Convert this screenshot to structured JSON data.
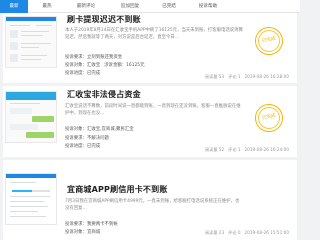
{
  "tabs": [
    {
      "label": "最新"
    },
    {
      "label": "最热"
    },
    {
      "label": "最新评论"
    },
    {
      "label": "追加回复"
    },
    {
      "label": "已完结"
    },
    {
      "label": "投诉帮助"
    }
  ],
  "complaints": [
    {
      "title": "刷卡提现迟迟不到账",
      "excerpt": "本人于2019年8月14日在汇收宝手机APP中刷了16125元，当天未到账，打客服电话说清算延迟，然后我就等了两天，对方说是后台延迟，直至今日…",
      "target_label": "投诉对象：",
      "target": "汇收宝",
      "demand_label": "投诉要求：",
      "demand": "立刻到账还我资金",
      "amount_label": "涉诉金额：",
      "amount": "16125元",
      "progress_label": "投诉进度：",
      "progress": "已完成",
      "views": "阅读量 53",
      "comments": "评论 1",
      "date": "2019-08-26 16:28:00",
      "stamp": "已完成"
    },
    {
      "title": "汇收宝非法侵占资金",
      "excerpt": "汇收宝说话不算数，前段时间说一直都能到账，一直到现在还没到账，客服一直推脱说在维护中，到现在也没…",
      "target_label": "投诉对象：",
      "target": "汇收宝,宜商城,聚民汇宝",
      "demand_label": "投诉要求：",
      "demand": "不解决问题",
      "progress_label": "投诉进度：",
      "progress": "已完成",
      "views": "阅读量 52",
      "comments": "评论 1",
      "date": "2019-08-26 16:24:00",
      "stamp": "已完成"
    },
    {
      "title": "宜商城APP刷信用卡不到账",
      "excerpt": "7月3日我在宜商城APP刷信用卡4999元，一直未到账，给客服打电话说系统正在维护，也没有回复…",
      "demand_label": "投诉要求：",
      "demand": "我要两卡不到帐",
      "target_label": "投诉对象：",
      "target": "宜商城",
      "views": "阅读量 23",
      "comments": "评论 0",
      "date": "2019-08-26 15:51:00"
    }
  ],
  "colors": {
    "accent": "#1e88e5",
    "stamp": "#f2b705"
  }
}
